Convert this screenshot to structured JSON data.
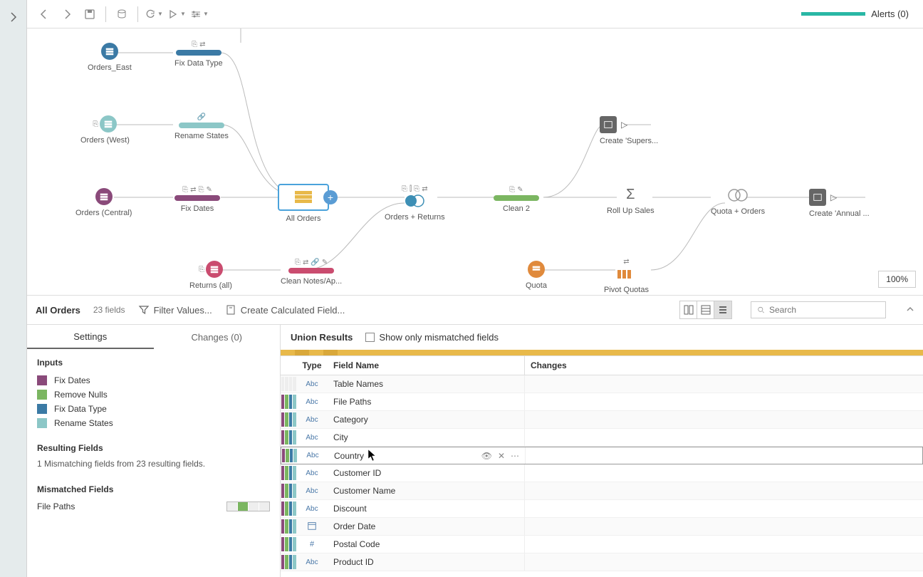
{
  "toolbar": {
    "alerts_label": "Alerts (0)"
  },
  "flow": {
    "nodes": {
      "orders_east": {
        "label": "Orders_East"
      },
      "orders_west": {
        "label": "Orders (West)"
      },
      "orders_central": {
        "label": "Orders (Central)"
      },
      "returns_all": {
        "label": "Returns (all)"
      },
      "fix_data_type": {
        "label": "Fix Data Type"
      },
      "rename_states": {
        "label": "Rename States"
      },
      "fix_dates": {
        "label": "Fix Dates"
      },
      "clean_notes": {
        "label": "Clean Notes/Ap..."
      },
      "all_orders": {
        "label": "All Orders"
      },
      "orders_returns": {
        "label": "Orders + Returns"
      },
      "clean2": {
        "label": "Clean 2"
      },
      "rollup_sales": {
        "label": "Roll Up Sales"
      },
      "quota_orders": {
        "label": "Quota + Orders"
      },
      "create_annual": {
        "label": "Create 'Annual ..."
      },
      "create_supers": {
        "label": "Create 'Supers..."
      },
      "quota": {
        "label": "Quota"
      },
      "pivot_quotas": {
        "label": "Pivot Quotas"
      }
    },
    "zoom": "100%"
  },
  "panel": {
    "title": "All Orders",
    "field_count": "23 fields",
    "filter_label": "Filter Values...",
    "calc_label": "Create Calculated Field...",
    "search_placeholder": "Search"
  },
  "left_pane": {
    "tabs": {
      "settings": "Settings",
      "changes": "Changes (0)"
    },
    "inputs_title": "Inputs",
    "inputs": [
      {
        "color": "#8a4a7a",
        "label": "Fix Dates"
      },
      {
        "color": "#7bb661",
        "label": "Remove Nulls"
      },
      {
        "color": "#3b7aa5",
        "label": "Fix Data Type"
      },
      {
        "color": "#8cc7c7",
        "label": "Rename States"
      }
    ],
    "resulting_title": "Resulting Fields",
    "resulting_text": "1 Mismatching fields from 23 resulting fields.",
    "mismatched_title": "Mismatched Fields",
    "mismatched_item": "File Paths"
  },
  "right_pane": {
    "union_results": "Union Results",
    "show_mismatch": "Show only mismatched fields",
    "columns": {
      "type": "Type",
      "field_name": "Field Name",
      "changes": "Changes"
    },
    "rows": [
      {
        "bars": [
          "#eee",
          "#eee",
          "#eee",
          "#eee"
        ],
        "type": "Abc",
        "name": "Table Names"
      },
      {
        "bars": [
          "#8a4a7a",
          "#7bb661",
          "#3b7aa5",
          "#8cc7c7"
        ],
        "type": "Abc",
        "name": "File Paths"
      },
      {
        "bars": [
          "#8a4a7a",
          "#7bb661",
          "#3b7aa5",
          "#8cc7c7"
        ],
        "type": "Abc",
        "name": "Category"
      },
      {
        "bars": [
          "#8a4a7a",
          "#7bb661",
          "#3b7aa5",
          "#8cc7c7"
        ],
        "type": "Abc",
        "name": "City"
      },
      {
        "bars": [
          "#8a4a7a",
          "#7bb661",
          "#3b7aa5",
          "#8cc7c7"
        ],
        "type": "Abc",
        "name": "Country",
        "hover": true
      },
      {
        "bars": [
          "#8a4a7a",
          "#7bb661",
          "#3b7aa5",
          "#8cc7c7"
        ],
        "type": "Abc",
        "name": "Customer ID"
      },
      {
        "bars": [
          "#8a4a7a",
          "#7bb661",
          "#3b7aa5",
          "#8cc7c7"
        ],
        "type": "Abc",
        "name": "Customer Name"
      },
      {
        "bars": [
          "#8a4a7a",
          "#7bb661",
          "#3b7aa5",
          "#8cc7c7"
        ],
        "type": "Abc",
        "name": "Discount"
      },
      {
        "bars": [
          "#8a4a7a",
          "#7bb661",
          "#3b7aa5",
          "#8cc7c7"
        ],
        "type": "date",
        "name": "Order Date"
      },
      {
        "bars": [
          "#8a4a7a",
          "#7bb661",
          "#3b7aa5",
          "#8cc7c7"
        ],
        "type": "#",
        "name": "Postal Code"
      },
      {
        "bars": [
          "#8a4a7a",
          "#7bb661",
          "#3b7aa5",
          "#8cc7c7"
        ],
        "type": "Abc",
        "name": "Product ID"
      }
    ]
  },
  "colors": {
    "purple": "#8a4a7a",
    "green": "#7bb661",
    "blue": "#3b7aa5",
    "teal": "#8cc7c7",
    "rose": "#ca4c6f",
    "orange": "#e08a3c",
    "yellow": "#e8b94a"
  }
}
